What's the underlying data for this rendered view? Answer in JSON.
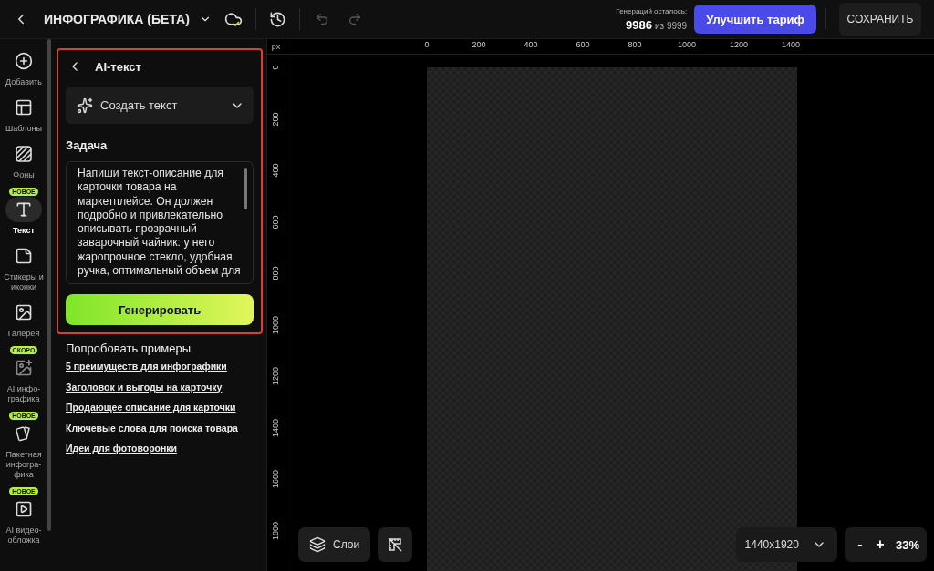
{
  "topbar": {
    "title": "ИНФОГРАФИКА (БЕТА)",
    "undo": {
      "disabled": true
    },
    "redo": {
      "disabled": true
    },
    "quota_label": "Генераций осталось:",
    "quota_used": "9986",
    "quota_total": "из 9999",
    "upgrade": "Улучшить тариф",
    "save": "СОХРАНИТЬ"
  },
  "sidebar": {
    "items": [
      {
        "label": "Добавить",
        "kind": "add",
        "selected": false
      },
      {
        "label": "Шаблоны",
        "kind": "templates",
        "selected": false
      },
      {
        "label": "Фоны",
        "kind": "backgrounds",
        "selected": false
      },
      {
        "label": "Текст",
        "kind": "text",
        "badge": "НОВОЕ",
        "selected": true
      },
      {
        "label": "Стикеры и иконки",
        "kind": "stickers",
        "selected": false
      },
      {
        "label": "Галерея",
        "kind": "gallery",
        "selected": false
      },
      {
        "label": "AI инфо-графика",
        "kind": "aiimage",
        "badge": "СКОРО",
        "selected": false
      },
      {
        "label": "Пакетная инфогра-фика",
        "kind": "cards",
        "badge": "НОВОЕ",
        "selected": false
      },
      {
        "label": "AI видео-обложка",
        "kind": "video",
        "badge": "НОВОЕ",
        "selected": false
      }
    ]
  },
  "panel": {
    "highlighted": true,
    "title": "AI-текст",
    "mode": "Создать текст",
    "task_label": "Задача",
    "task_text": "Напиши текст-описание для карточки товара на маркетплейсе. Он должен подробно и привлекательно описывать прозрачный заварочный чайник: у него жаропрочное стекло, удобная ручка, оптимальный объем для",
    "generate": "Генерировать",
    "examples_title": "Попробовать примеры",
    "examples": [
      "5 преимуществ для инфографики",
      "Заголовок и выгоды на карточку",
      "Продающее описание для карточки",
      "Ключевые слова для поиска товара",
      "Идеи для фотоворонки"
    ]
  },
  "canvas": {
    "unit": "px",
    "x_ticks": [
      "0",
      "200",
      "400",
      "600",
      "800",
      "1000",
      "1200",
      "1400"
    ],
    "y_ticks": [
      "0",
      "200",
      "400",
      "600",
      "800",
      "1000",
      "1200",
      "1400",
      "1600",
      "1800"
    ],
    "layers": "Слои",
    "size": "1440x1920",
    "zoom_out": "-",
    "zoom_in": "+",
    "zoom": "33%"
  }
}
